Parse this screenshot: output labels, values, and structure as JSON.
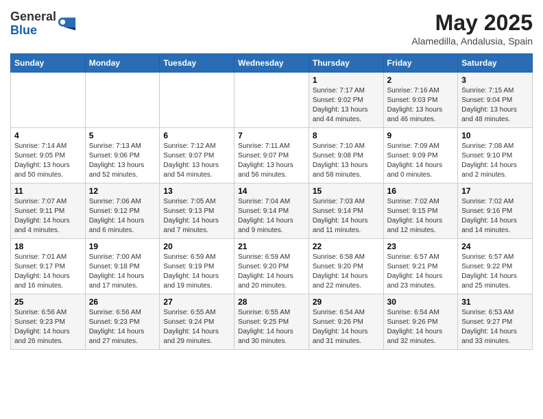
{
  "header": {
    "logo_line1": "General",
    "logo_line2": "Blue",
    "month_year": "May 2025",
    "location": "Alamedilla, Andalusia, Spain"
  },
  "days_of_week": [
    "Sunday",
    "Monday",
    "Tuesday",
    "Wednesday",
    "Thursday",
    "Friday",
    "Saturday"
  ],
  "weeks": [
    [
      {
        "day": "",
        "info": ""
      },
      {
        "day": "",
        "info": ""
      },
      {
        "day": "",
        "info": ""
      },
      {
        "day": "",
        "info": ""
      },
      {
        "day": "1",
        "info": "Sunrise: 7:17 AM\nSunset: 9:02 PM\nDaylight: 13 hours\nand 44 minutes."
      },
      {
        "day": "2",
        "info": "Sunrise: 7:16 AM\nSunset: 9:03 PM\nDaylight: 13 hours\nand 46 minutes."
      },
      {
        "day": "3",
        "info": "Sunrise: 7:15 AM\nSunset: 9:04 PM\nDaylight: 13 hours\nand 48 minutes."
      }
    ],
    [
      {
        "day": "4",
        "info": "Sunrise: 7:14 AM\nSunset: 9:05 PM\nDaylight: 13 hours\nand 50 minutes."
      },
      {
        "day": "5",
        "info": "Sunrise: 7:13 AM\nSunset: 9:06 PM\nDaylight: 13 hours\nand 52 minutes."
      },
      {
        "day": "6",
        "info": "Sunrise: 7:12 AM\nSunset: 9:07 PM\nDaylight: 13 hours\nand 54 minutes."
      },
      {
        "day": "7",
        "info": "Sunrise: 7:11 AM\nSunset: 9:07 PM\nDaylight: 13 hours\nand 56 minutes."
      },
      {
        "day": "8",
        "info": "Sunrise: 7:10 AM\nSunset: 9:08 PM\nDaylight: 13 hours\nand 58 minutes."
      },
      {
        "day": "9",
        "info": "Sunrise: 7:09 AM\nSunset: 9:09 PM\nDaylight: 14 hours\nand 0 minutes."
      },
      {
        "day": "10",
        "info": "Sunrise: 7:08 AM\nSunset: 9:10 PM\nDaylight: 14 hours\nand 2 minutes."
      }
    ],
    [
      {
        "day": "11",
        "info": "Sunrise: 7:07 AM\nSunset: 9:11 PM\nDaylight: 14 hours\nand 4 minutes."
      },
      {
        "day": "12",
        "info": "Sunrise: 7:06 AM\nSunset: 9:12 PM\nDaylight: 14 hours\nand 6 minutes."
      },
      {
        "day": "13",
        "info": "Sunrise: 7:05 AM\nSunset: 9:13 PM\nDaylight: 14 hours\nand 7 minutes."
      },
      {
        "day": "14",
        "info": "Sunrise: 7:04 AM\nSunset: 9:14 PM\nDaylight: 14 hours\nand 9 minutes."
      },
      {
        "day": "15",
        "info": "Sunrise: 7:03 AM\nSunset: 9:14 PM\nDaylight: 14 hours\nand 11 minutes."
      },
      {
        "day": "16",
        "info": "Sunrise: 7:02 AM\nSunset: 9:15 PM\nDaylight: 14 hours\nand 12 minutes."
      },
      {
        "day": "17",
        "info": "Sunrise: 7:02 AM\nSunset: 9:16 PM\nDaylight: 14 hours\nand 14 minutes."
      }
    ],
    [
      {
        "day": "18",
        "info": "Sunrise: 7:01 AM\nSunset: 9:17 PM\nDaylight: 14 hours\nand 16 minutes."
      },
      {
        "day": "19",
        "info": "Sunrise: 7:00 AM\nSunset: 9:18 PM\nDaylight: 14 hours\nand 17 minutes."
      },
      {
        "day": "20",
        "info": "Sunrise: 6:59 AM\nSunset: 9:19 PM\nDaylight: 14 hours\nand 19 minutes."
      },
      {
        "day": "21",
        "info": "Sunrise: 6:59 AM\nSunset: 9:20 PM\nDaylight: 14 hours\nand 20 minutes."
      },
      {
        "day": "22",
        "info": "Sunrise: 6:58 AM\nSunset: 9:20 PM\nDaylight: 14 hours\nand 22 minutes."
      },
      {
        "day": "23",
        "info": "Sunrise: 6:57 AM\nSunset: 9:21 PM\nDaylight: 14 hours\nand 23 minutes."
      },
      {
        "day": "24",
        "info": "Sunrise: 6:57 AM\nSunset: 9:22 PM\nDaylight: 14 hours\nand 25 minutes."
      }
    ],
    [
      {
        "day": "25",
        "info": "Sunrise: 6:56 AM\nSunset: 9:23 PM\nDaylight: 14 hours\nand 26 minutes."
      },
      {
        "day": "26",
        "info": "Sunrise: 6:56 AM\nSunset: 9:23 PM\nDaylight: 14 hours\nand 27 minutes."
      },
      {
        "day": "27",
        "info": "Sunrise: 6:55 AM\nSunset: 9:24 PM\nDaylight: 14 hours\nand 29 minutes."
      },
      {
        "day": "28",
        "info": "Sunrise: 6:55 AM\nSunset: 9:25 PM\nDaylight: 14 hours\nand 30 minutes."
      },
      {
        "day": "29",
        "info": "Sunrise: 6:54 AM\nSunset: 9:26 PM\nDaylight: 14 hours\nand 31 minutes."
      },
      {
        "day": "30",
        "info": "Sunrise: 6:54 AM\nSunset: 9:26 PM\nDaylight: 14 hours\nand 32 minutes."
      },
      {
        "day": "31",
        "info": "Sunrise: 6:53 AM\nSunset: 9:27 PM\nDaylight: 14 hours\nand 33 minutes."
      }
    ]
  ]
}
